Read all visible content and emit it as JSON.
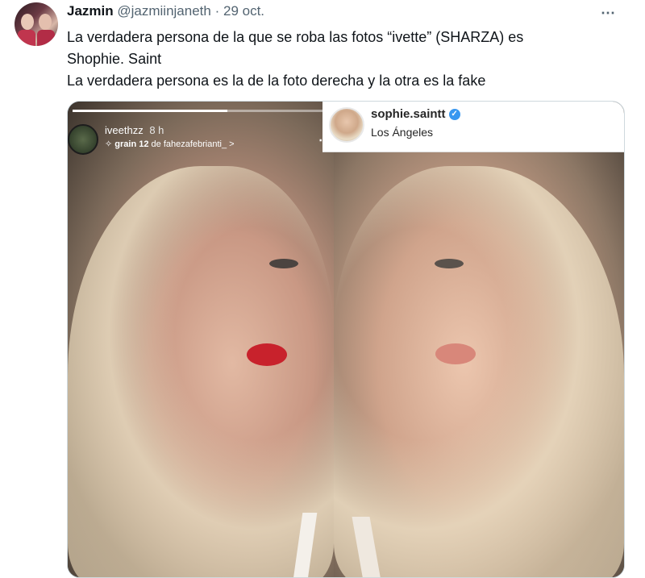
{
  "tweet": {
    "author_name": "Jazmin",
    "author_handle": "@jazmiinjaneth",
    "separator": "·",
    "date": "29 oct.",
    "more_icon": "⋯",
    "text_lines": [
      "La verdadera persona de la que se roba las fotos “ivette” (SHARZA) es",
      "Shophie. Saint",
      "La verdadera persona es la de la foto derecha y la otra es la fake"
    ]
  },
  "media": {
    "left_story": {
      "username": "iveethzz",
      "time": "8 h",
      "music_icon": "✧",
      "music_title": "grain 12",
      "music_artist": "de fahezafebrianti_",
      "chevron": ">",
      "more_icon": "⋯"
    },
    "right_post": {
      "username": "sophie.saintt",
      "verified_icon": "✓",
      "location": "Los Ángeles"
    }
  },
  "colors": {
    "text_primary": "#0f1419",
    "text_secondary": "#536471",
    "verified_blue": "#3897f0"
  }
}
